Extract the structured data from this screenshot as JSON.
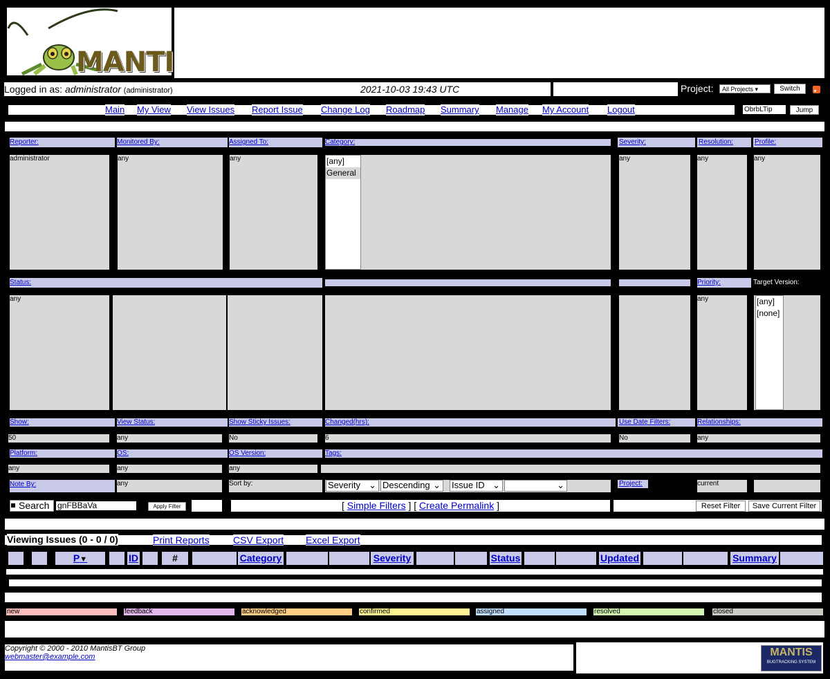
{
  "logo": {
    "word": "MANTIS"
  },
  "header": {
    "logged_in_prefix": "Logged in as: ",
    "username": "administrator",
    "role": "(administrator)",
    "timestamp": "2021-10-03 19:43 UTC",
    "project_label": "Project:",
    "project_value": "All Projects",
    "switch_label": "Switch",
    "rss_icon": "rss-icon"
  },
  "menu": {
    "items": [
      "Main",
      "My View",
      "View Issues",
      "Report Issue",
      "Change Log",
      "Roadmap",
      "Summary",
      "Manage",
      "My Account",
      "Logout"
    ],
    "jump_value": "ObrbLTip",
    "jump_label": "Jump"
  },
  "filters": {
    "row1": {
      "reporter": "Reporter:",
      "monitored_by": "Monitored By:",
      "assigned_to": "Assigned To:",
      "category": "Category:",
      "severity": "Severity:",
      "resolution": "Resolution:",
      "profile": "Profile:"
    },
    "row1_values": {
      "reporter": "administrator",
      "monitored_by": "any",
      "assigned_to": "any",
      "category_options": [
        "[any]",
        "General"
      ],
      "severity": "any",
      "resolution": "any",
      "profile": "any"
    },
    "row2": {
      "status": "Status:",
      "priority": "Priority:",
      "target_version": "Target Version:"
    },
    "row2_values": {
      "status": "any",
      "priority": "any",
      "target_version_options": [
        "[any]",
        "[none]"
      ]
    },
    "row3": {
      "show": "Show:",
      "view_status": "View Status:",
      "show_sticky": "Show Sticky Issues:",
      "changed": "Changed(hrs):",
      "use_date": "Use Date Filters:",
      "relationships": "Relationships:"
    },
    "row3_values": {
      "show": "50",
      "view_status": "any",
      "show_sticky": "No",
      "changed": "6",
      "use_date": "No",
      "relationships": "any"
    },
    "row4": {
      "platform": "Platform:",
      "os": "OS:",
      "os_version": "OS Version:",
      "tags": "Tags:"
    },
    "row4_values": {
      "platform": "any",
      "os": "any",
      "os_version": "any"
    },
    "row5": {
      "note_by": "Note By:",
      "note_by_value": "any",
      "sort_by": "Sort by:",
      "project": "Project:",
      "project_value": "current"
    },
    "sort": {
      "field1": "Severity",
      "dir1": "Descending",
      "field2": "Issue ID",
      "dir2": ""
    },
    "search_label": "Search",
    "search_value": "gnFBBaVa",
    "apply_label": "Apply Filter",
    "simple_filters": "Simple Filters",
    "create_permalink": "Create Permalink",
    "reset_label": "Reset Filter",
    "save_label": "Save Current Filter"
  },
  "issues": {
    "heading": "Viewing Issues (0 - 0 / 0)",
    "print_reports": "Print Reports",
    "csv_export": "CSV Export",
    "excel_export": "Excel Export",
    "columns": {
      "p": "P",
      "id": "ID",
      "hash": "#",
      "category": "Category",
      "severity": "Severity",
      "status": "Status",
      "updated": "Updated",
      "summary": "Summary"
    }
  },
  "legend": [
    {
      "label": "new",
      "color": "#fcbdbd"
    },
    {
      "label": "feedback",
      "color": "#e3b7eb"
    },
    {
      "label": "acknowledged",
      "color": "#ffcd85"
    },
    {
      "label": "confirmed",
      "color": "#fff494"
    },
    {
      "label": "assigned",
      "color": "#c2dfff"
    },
    {
      "label": "resolved",
      "color": "#d2f5b0"
    },
    {
      "label": "closed",
      "color": "#c9ccc4"
    }
  ],
  "footer": {
    "copyright": "Copyright © 2000 - 2010 MantisBT Group",
    "email": "webmaster@example.com",
    "badge_title": "MANTIS",
    "badge_sub": "BUGTRACKING SYSTEM"
  }
}
